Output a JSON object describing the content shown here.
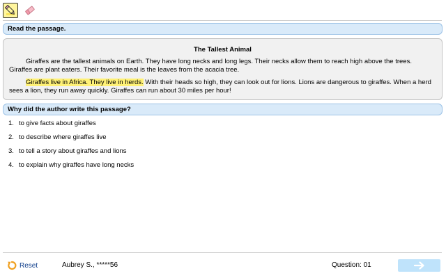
{
  "toolbar": {
    "highlighter_icon": "highlighter-pencil-icon",
    "eraser_icon": "eraser-icon"
  },
  "passage_section": {
    "header": "Read the passage."
  },
  "passage": {
    "title": "The Tallest Animal",
    "paragraph1": "Giraffes are the tallest animals on Earth. They have long necks and long legs. Their necks allow them to reach high above the trees. Giraffes are plant eaters. Their favorite meal is the leaves from the acacia tree.",
    "paragraph2_highlighted": "Giraffes live in Africa. They live in herds.",
    "paragraph2_rest": " With their heads so high, they can look out for lions. Lions are dangerous to giraffes. When a herd sees a lion, they run away quickly. Giraffes can run about 30 miles per hour!"
  },
  "question": {
    "header": "Why did the author write this passage?",
    "answers": [
      {
        "num": "1.",
        "text": "to give facts about giraffes"
      },
      {
        "num": "2.",
        "text": "to describe where giraffes live"
      },
      {
        "num": "3.",
        "text": "to tell a story about giraffes and lions"
      },
      {
        "num": "4.",
        "text": "to explain why giraffes have long necks"
      }
    ]
  },
  "footer": {
    "reset_label": "Reset",
    "student": "Aubrey S., *****56",
    "question_label": "Question: 01"
  },
  "colors": {
    "header_bg": "#d9eaf9",
    "highlight": "#fff176",
    "next_button": "#bfe3fb",
    "reset_icon": "#f0a020"
  }
}
